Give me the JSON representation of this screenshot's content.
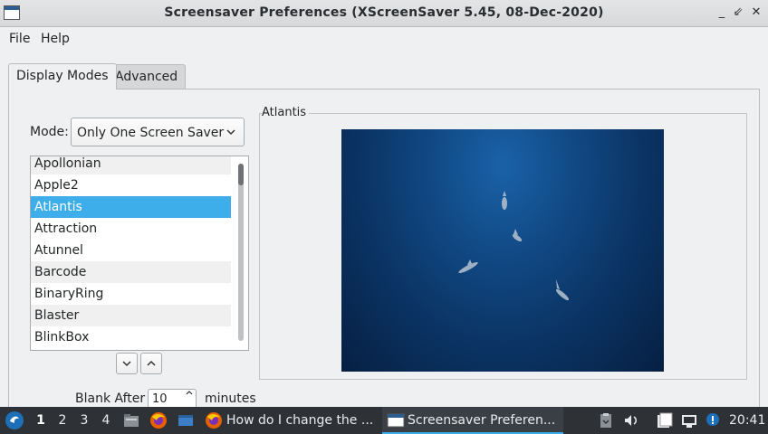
{
  "window": {
    "title": "Screensaver Preferences  (XScreenSaver 5.45, 08-Dec-2020)",
    "controls": {
      "minimize": "_",
      "restore": "⇙",
      "close": "✕"
    }
  },
  "menubar": {
    "file": "File",
    "help": "Help"
  },
  "tabs": {
    "display_modes": "Display Modes",
    "advanced": "Advanced"
  },
  "mode": {
    "label": "Mode:",
    "selected": "Only One Screen Saver"
  },
  "savers": [
    "Apollonian",
    "Apple2",
    "Atlantis",
    "Attraction",
    "Atunnel",
    "Barcode",
    "BinaryRing",
    "Blaster",
    "BlinkBox"
  ],
  "selected_saver": "Atlantis",
  "preview": {
    "label": "Atlantis"
  },
  "blank_after": {
    "label": "Blank After",
    "value": "10",
    "unit": "minutes"
  },
  "taskbar": {
    "workspaces": [
      "1",
      "2",
      "3",
      "4"
    ],
    "windows": [
      {
        "title": "How do I change the ...",
        "icon": "firefox-icon"
      },
      {
        "title": "Screensaver Preferen...",
        "icon": "window-icon"
      }
    ],
    "clock": "20:41"
  },
  "colors": {
    "selection": "#3daee9",
    "taskbar": "#2e3237",
    "ocean": "#0b3566"
  }
}
